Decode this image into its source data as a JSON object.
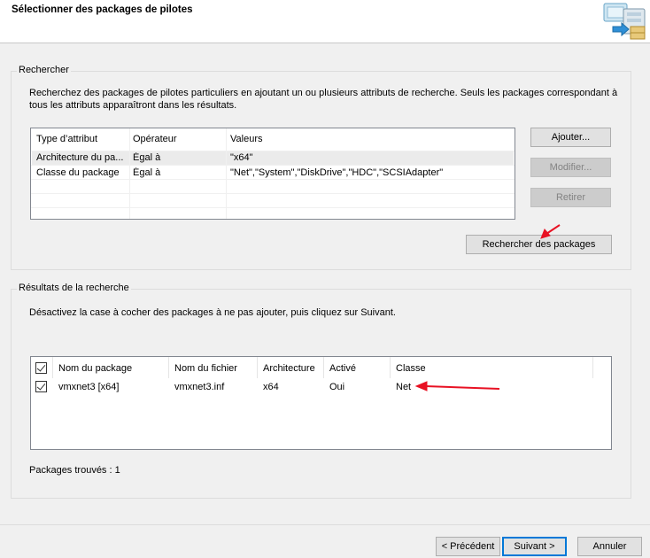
{
  "header": {
    "title": "Sélectionner des packages de pilotes"
  },
  "search": {
    "group_label": "Rechercher",
    "description": "Recherchez des packages de pilotes particuliers en ajoutant un ou plusieurs attributs de recherche. Seuls les packages correspondant à tous les attributs apparaîtront dans les résultats.",
    "columns": [
      "Type d’attribut",
      "Opérateur",
      "Valeurs"
    ],
    "rows": [
      {
        "type": "Architecture du pa...",
        "operator": "Égal à",
        "values": "\"x64\""
      },
      {
        "type": "Classe du package",
        "operator": "Égal à",
        "values": "\"Net\",\"System\",\"DiskDrive\",\"HDC\",\"SCSIAdapter\""
      }
    ],
    "buttons": {
      "add": "Ajouter...",
      "modify": "Modifier...",
      "remove": "Retirer",
      "search": "Rechercher des packages"
    }
  },
  "results": {
    "group_label": "Résultats de la recherche",
    "description": "Désactivez la case à cocher des packages à ne pas ajouter, puis cliquez sur Suivant.",
    "columns": [
      "Nom du package",
      "Nom du fichier",
      "Architecture",
      "Activé",
      "Classe"
    ],
    "rows": [
      {
        "checked": true,
        "name": "vmxnet3 [x64]",
        "file": "vmxnet3.inf",
        "arch": "x64",
        "enabled": "Oui",
        "class": "Net"
      }
    ],
    "found_text": "Packages trouvés : 1"
  },
  "footer": {
    "previous": "< Précédent",
    "next": "Suivant >",
    "cancel": "Annuler"
  },
  "colors": {
    "accent": "#0078d7",
    "arrow": "#e81123"
  }
}
